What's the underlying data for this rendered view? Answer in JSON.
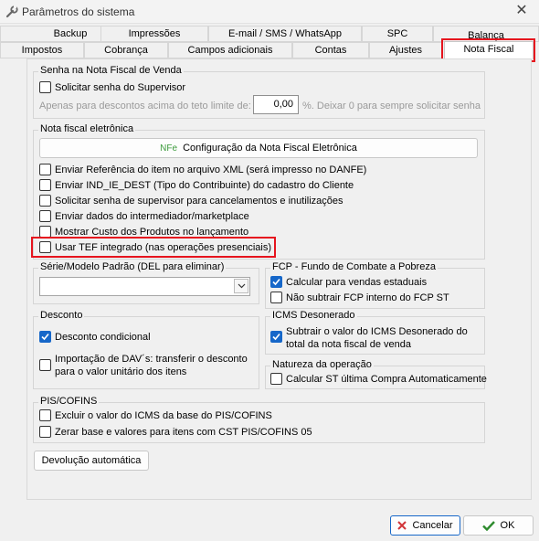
{
  "window": {
    "title": "Parâmetros do sistema",
    "close_glyph": "✕"
  },
  "tabs": {
    "row_top": [
      "Backup",
      "Impressões",
      "E-mail / SMS / WhatsApp",
      "SPC",
      "Balança"
    ],
    "row_bottom": [
      "Impostos",
      "Cobrança",
      "Campos adicionais",
      "Contas",
      "Ajustes",
      "Nota Fiscal"
    ],
    "active": "Nota Fiscal"
  },
  "senha_nf_venda": {
    "legend": "Senha na Nota Fiscal de Venda",
    "solicitar_label": "Solicitar senha do Supervisor",
    "solicitar_checked": false,
    "teto_prefix": "Apenas para descontos acima do teto limite de:",
    "teto_value": "0,00",
    "teto_suffix": "%. Deixar 0 para sempre solicitar senha"
  },
  "nfe": {
    "legend": "Nota fiscal eletrônica",
    "config_button_icon": "NFe",
    "config_button_label": "Configuração da Nota Fiscal Eletrônica",
    "options": [
      {
        "label": "Enviar Referência do item no arquivo XML (será impresso no DANFE)",
        "checked": false
      },
      {
        "label": "Enviar IND_IE_DEST (Tipo do Contribuinte) do cadastro do Cliente",
        "checked": false
      },
      {
        "label": "Solicitar senha de supervisor para cancelamentos e inutilizações",
        "checked": false
      },
      {
        "label": "Enviar dados do intermediador/marketplace",
        "checked": false
      },
      {
        "label": "Mostrar Custo dos Produtos no lançamento",
        "checked": false
      },
      {
        "label": "Usar TEF integrado (nas operações presenciais)",
        "checked": false
      }
    ]
  },
  "serie_modelo": {
    "legend": "Série/Modelo Padrão (DEL para eliminar)",
    "value": ""
  },
  "fcp": {
    "legend": "FCP - Fundo de Combate a Pobreza",
    "calcular_label": "Calcular para vendas estaduais",
    "calcular_checked": true,
    "nao_subtrair_label": "Não subtrair FCP interno do FCP ST",
    "nao_subtrair_checked": false
  },
  "desconto": {
    "legend": "Desconto",
    "condicional_label": "Desconto condicional",
    "condicional_checked": true,
    "importacao_label": "Importação de DAV´s: transferir o desconto para o valor unitário dos itens",
    "importacao_checked": false
  },
  "icms_desonerado": {
    "legend": "ICMS Desonerado",
    "subtrair_label": "Subtrair o valor do ICMS Desonerado do total da nota fiscal de venda",
    "subtrair_checked": true
  },
  "natureza": {
    "legend": "Natureza da operação",
    "calcular_st_label": "Calcular ST última Compra Automaticamente",
    "calcular_st_checked": false
  },
  "pis_cofins": {
    "legend": "PIS/COFINS",
    "excluir_label": "Excluir o valor do ICMS da base do PIS/COFINS",
    "excluir_checked": false,
    "zerar_label": "Zerar base e valores para itens com CST PIS/COFINS 05",
    "zerar_checked": false
  },
  "devolucao_label": "Devolução automática",
  "footer": {
    "cancel_label": "Cancelar",
    "ok_label": "OK"
  },
  "colors": {
    "accent": "#1667c9",
    "highlight": "#e6141e",
    "cancel_x": "#d13438",
    "ok_check": "#2e8b2e"
  }
}
